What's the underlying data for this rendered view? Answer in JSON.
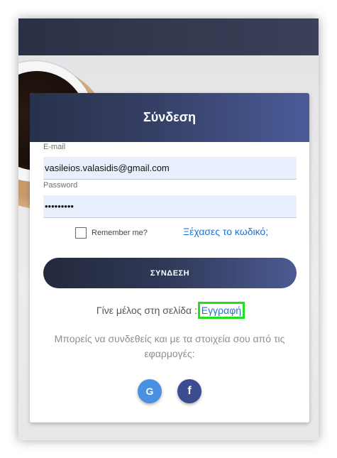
{
  "card": {
    "title": "Σύνδεση"
  },
  "form": {
    "email_label": "E-mail",
    "email_value": "vasileios.valasidis@gmail.com",
    "password_label": "Password",
    "password_value": "•••••••••",
    "remember_label": "Remember me?",
    "remember_checked": false,
    "forgot_link": "Ξέχασες το κωδικό;",
    "login_button": "ΣΥΝΔΕΣΗ"
  },
  "signup": {
    "prompt": "Γίνε μέλος στη σελίδα : ",
    "link": "Εγγραφή"
  },
  "social": {
    "text": "Μπορείς να συνδεθείς και με τα στοιχεία σου από τις εφαρμογές:",
    "google_glyph": "G",
    "facebook_glyph": "f",
    "icons": [
      "google-icon",
      "facebook-icon"
    ]
  },
  "colors": {
    "accent": "#4a5b98",
    "link": "#1e72d0",
    "highlight": "#22e01c",
    "google": "#4a90e2",
    "facebook": "#3b4c8f"
  }
}
